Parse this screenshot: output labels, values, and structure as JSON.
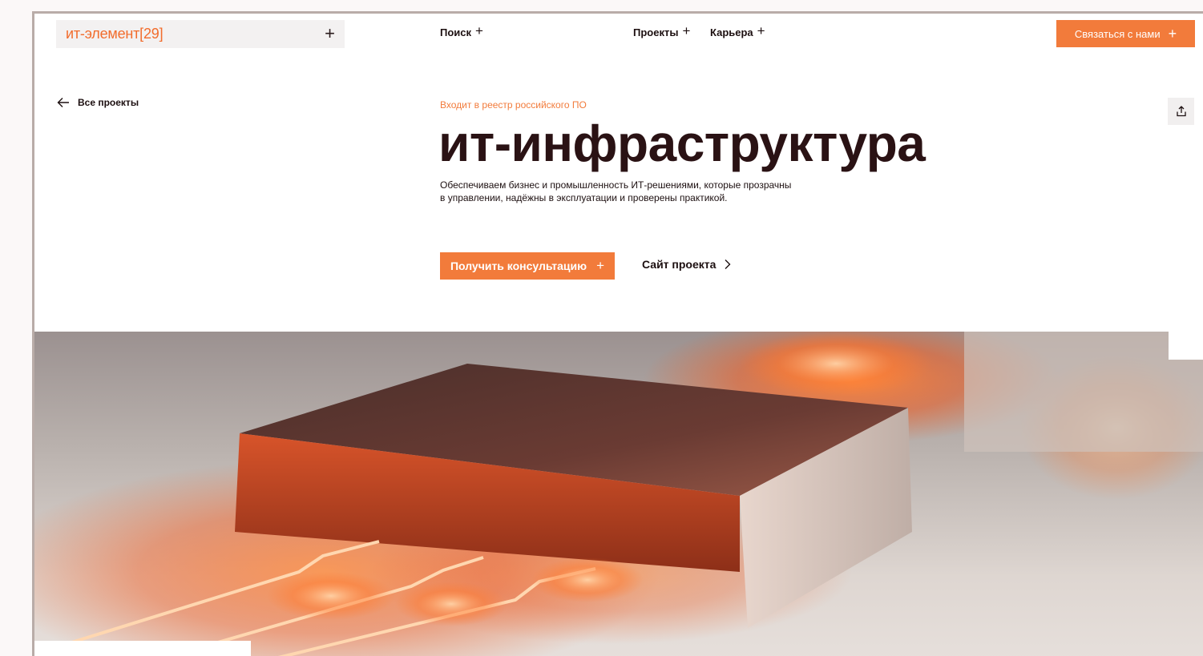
{
  "header": {
    "logo": "ит-элемент[29]",
    "logo_plus": "+",
    "nav": [
      {
        "label": "Поиск",
        "plus": "+"
      },
      {
        "label": "Проекты",
        "plus": "+"
      },
      {
        "label": "Карьера",
        "plus": "+"
      }
    ],
    "contact_label": "Связаться с нами",
    "contact_plus": "+"
  },
  "back_link": "Все проекты",
  "hero": {
    "registry": "Входит в реестр российского ПО",
    "title": "ит-инфраструктура",
    "description": "Обеспечиваем бизнес и промышленность ИТ-решениями, которые прозрачны в управлении, надёжны в эксплуатации и проверены практикой.",
    "consult_label": "Получить консультацию",
    "consult_plus": "+",
    "site_label": "Сайт проекта"
  },
  "icons": {
    "back": "arrow-left-icon",
    "share": "share-icon",
    "site": "chevron-right-icon"
  },
  "colors": {
    "accent": "#f27b3b",
    "text": "#1c0f10"
  }
}
